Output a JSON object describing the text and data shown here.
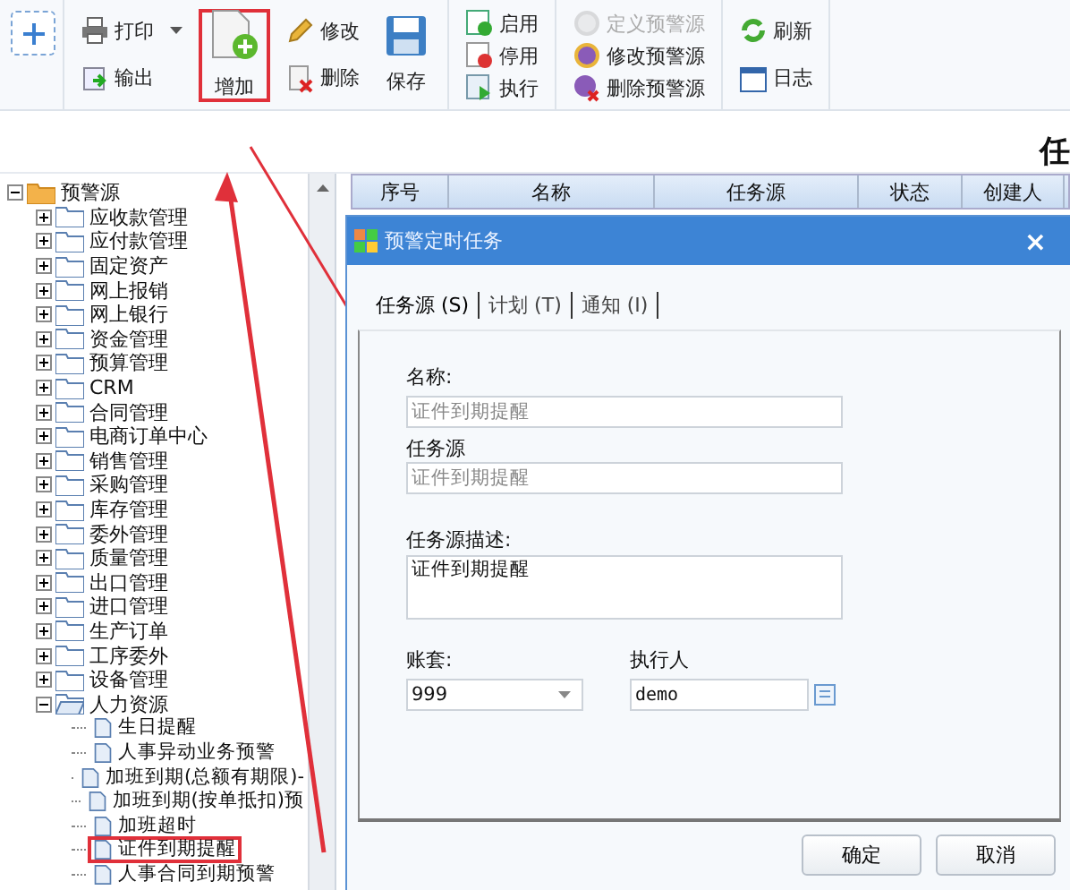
{
  "toolbar": {
    "groups": [
      {
        "columns": [
          [
            {
              "label": "打印",
              "kind": "small",
              "dropdown": true,
              "disabled": false,
              "highlighted": false
            },
            {
              "label": "输出",
              "kind": "small",
              "disabled": false,
              "highlighted": false
            }
          ],
          [
            {
              "label": "增加",
              "kind": "large",
              "disabled": false,
              "highlighted": true
            }
          ],
          [
            {
              "label": "修改",
              "kind": "small",
              "disabled": false,
              "highlighted": false
            },
            {
              "label": "删除",
              "kind": "small",
              "disabled": false,
              "highlighted": false
            }
          ],
          [
            {
              "label": "保存",
              "kind": "large",
              "disabled": false,
              "highlighted": false
            }
          ]
        ]
      },
      {
        "columns": [
          [
            {
              "label": "启用",
              "kind": "small",
              "disabled": false,
              "highlighted": false
            },
            {
              "label": "停用",
              "kind": "small",
              "disabled": false,
              "highlighted": false
            },
            {
              "label": "执行",
              "kind": "small",
              "disabled": false,
              "highlighted": false
            }
          ]
        ]
      },
      {
        "columns": [
          [
            {
              "label": "定义预警源",
              "kind": "small",
              "disabled": true,
              "highlighted": false
            },
            {
              "label": "修改预警源",
              "kind": "small",
              "disabled": false,
              "highlighted": false
            },
            {
              "label": "删除预警源",
              "kind": "small",
              "disabled": false,
              "highlighted": false
            }
          ]
        ]
      },
      {
        "columns": [
          [
            {
              "label": "刷新",
              "kind": "small",
              "disabled": false,
              "highlighted": false
            },
            {
              "label": "日志",
              "kind": "small",
              "disabled": false,
              "highlighted": false
            }
          ]
        ]
      }
    ]
  },
  "page_title": "任",
  "tree": {
    "label": "预警源",
    "kind": "folder",
    "expanded": true,
    "children": [
      {
        "label": "应收款管理",
        "kind": "folder",
        "expanded": false
      },
      {
        "label": "应付款管理",
        "kind": "folder",
        "expanded": false
      },
      {
        "label": "固定资产",
        "kind": "folder",
        "expanded": false
      },
      {
        "label": "网上报销",
        "kind": "folder",
        "expanded": false
      },
      {
        "label": "网上银行",
        "kind": "folder",
        "expanded": false
      },
      {
        "label": "资金管理",
        "kind": "folder",
        "expanded": false
      },
      {
        "label": "预算管理",
        "kind": "folder",
        "expanded": false
      },
      {
        "label": "CRM",
        "kind": "folder",
        "expanded": false
      },
      {
        "label": "合同管理",
        "kind": "folder",
        "expanded": false
      },
      {
        "label": "电商订单中心",
        "kind": "folder",
        "expanded": false
      },
      {
        "label": "销售管理",
        "kind": "folder",
        "expanded": false
      },
      {
        "label": "采购管理",
        "kind": "folder",
        "expanded": false
      },
      {
        "label": "库存管理",
        "kind": "folder",
        "expanded": false
      },
      {
        "label": "委外管理",
        "kind": "folder",
        "expanded": false
      },
      {
        "label": "质量管理",
        "kind": "folder",
        "expanded": false
      },
      {
        "label": "出口管理",
        "kind": "folder",
        "expanded": false
      },
      {
        "label": "进口管理",
        "kind": "folder",
        "expanded": false
      },
      {
        "label": "生产订单",
        "kind": "folder",
        "expanded": false
      },
      {
        "label": "工序委外",
        "kind": "folder",
        "expanded": false
      },
      {
        "label": "设备管理",
        "kind": "folder",
        "expanded": false
      },
      {
        "label": "人力资源",
        "kind": "folder",
        "expanded": true,
        "children": [
          {
            "label": "生日提醒",
            "kind": "document",
            "highlighted": false
          },
          {
            "label": "人事异动业务预警",
            "kind": "document",
            "highlighted": false
          },
          {
            "label": "加班到期(总额有期限)-",
            "kind": "document",
            "highlighted": false
          },
          {
            "label": "加班到期(按单抵扣)预",
            "kind": "document",
            "highlighted": false
          },
          {
            "label": "加班超时",
            "kind": "document",
            "highlighted": false
          },
          {
            "label": "证件到期提醒",
            "kind": "document",
            "highlighted": true
          },
          {
            "label": "人事合同到期预警",
            "kind": "document",
            "highlighted": false
          }
        ]
      }
    ]
  },
  "table": {
    "columns": [
      "序号",
      "名称",
      "任务源",
      "状态",
      "创建人"
    ]
  },
  "dialog": {
    "title": "预警定时任务",
    "close": "×",
    "tabs": [
      {
        "label": "任务源 (S)",
        "selected": true
      },
      {
        "label": "计划 (T)",
        "selected": false
      },
      {
        "label": "通知 (I)",
        "selected": false
      }
    ],
    "name": {
      "label": "名称:",
      "value": "证件到期提醒",
      "disabled": true
    },
    "source": {
      "label": "任务源",
      "value": "证件到期提醒",
      "disabled": true
    },
    "description": {
      "label": "任务源描述:",
      "value": "证件到期提醒"
    },
    "account": {
      "label": "账套:",
      "value": "999"
    },
    "executor": {
      "label": "执行人",
      "value": "demo"
    },
    "buttons": [
      "确定",
      "取消"
    ]
  }
}
